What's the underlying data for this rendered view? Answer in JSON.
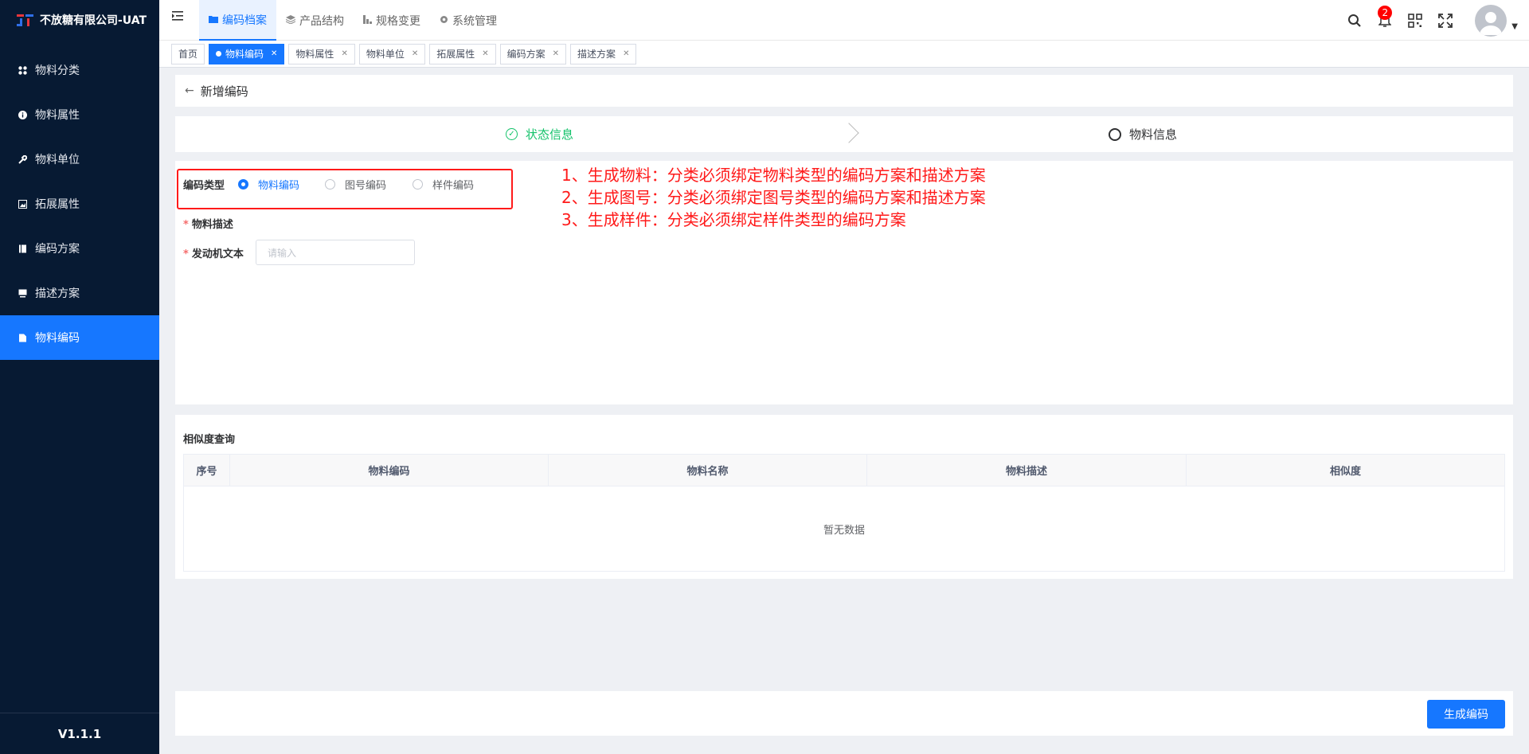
{
  "app": {
    "title": "不放糖有限公司-UAT",
    "version": "V1.1.1"
  },
  "sidebar": {
    "items": [
      {
        "label": "物料分类",
        "icon": "grid-icon"
      },
      {
        "label": "物料属性",
        "icon": "info-icon"
      },
      {
        "label": "物料单位",
        "icon": "wrench-icon"
      },
      {
        "label": "拓展属性",
        "icon": "image-icon"
      },
      {
        "label": "编码方案",
        "icon": "book-icon"
      },
      {
        "label": "描述方案",
        "icon": "monitor-icon"
      },
      {
        "label": "物料编码",
        "icon": "doc-icon",
        "active": true
      }
    ]
  },
  "topnav": {
    "items": [
      {
        "label": "编码档案",
        "active": true
      },
      {
        "label": "产品结构"
      },
      {
        "label": "规格变更"
      },
      {
        "label": "系统管理"
      }
    ],
    "notification_count": "2"
  },
  "tags": [
    {
      "label": "首页",
      "closable": false
    },
    {
      "label": "物料编码",
      "active": true
    },
    {
      "label": "物料属性"
    },
    {
      "label": "物料单位"
    },
    {
      "label": "拓展属性"
    },
    {
      "label": "编码方案"
    },
    {
      "label": "描述方案"
    }
  ],
  "page": {
    "back_title": "新增编码",
    "steps": [
      {
        "label": "状态信息",
        "status": "done"
      },
      {
        "label": "物料信息",
        "status": "pending"
      }
    ]
  },
  "form": {
    "code_type_label": "编码类型",
    "code_type_options": [
      "物料编码",
      "图号编码",
      "样件编码"
    ],
    "code_type_selected": "物料编码",
    "desc_label": "物料描述",
    "engine_label": "发动机文本",
    "engine_placeholder": "请输入",
    "notes": [
      "1、生成物料：分类必须绑定物料类型的编码方案和描述方案",
      "2、生成图号：分类必须绑定图号类型的编码方案和描述方案",
      "3、生成样件：分类必须绑定样件类型的编码方案"
    ]
  },
  "similarity": {
    "title": "相似度查询",
    "columns": [
      "序号",
      "物料编码",
      "物料名称",
      "物料描述",
      "相似度"
    ],
    "empty_text": "暂无数据"
  },
  "actions": {
    "generate_label": "生成编码"
  }
}
